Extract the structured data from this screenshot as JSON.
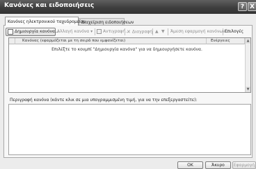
{
  "window": {
    "title": "Κανόνες και ειδοποιήσεις",
    "help_icon": "question-mark-icon",
    "close_icon": "close-x-icon",
    "help_glyph": "?",
    "close_glyph": "X"
  },
  "tabs": [
    {
      "label": "Κανόνες ηλεκτρονικού ταχυδρομείου",
      "active": true
    },
    {
      "label": "Διαχείριση ειδοποιήσεων",
      "active": false
    }
  ],
  "toolbar": {
    "new_rule": "Δημιουργία κανόνα...",
    "change_rule": "Αλλαγή κανόνα",
    "copy": "Αντιγραφή...",
    "delete": "Διαγραφή",
    "run_rules": "Άμεση εφαρμογή κανόνων...",
    "options": "Επιλογές",
    "move_up_glyph": "▲",
    "move_down_glyph": "▼",
    "delete_glyph": "✕",
    "dropdown_glyph": "▾"
  },
  "rules_list": {
    "columns": [
      "",
      "Κανόνας (εφαρμόζεται με τη σειρά που εμφανίζεται)",
      "Ενέργειες"
    ],
    "empty_message": "Επιλέξτε το κουμπί \"Δημιουργία κανόνα\" για να δημιουργήσετε κανόνα."
  },
  "description": {
    "label": "Περιγραφή κανόνα (κάντε κλικ σε μια υπογραμμισμένη τιμή, για να την επεξεργαστείτε):",
    "text": ""
  },
  "buttons": {
    "ok": "OK",
    "cancel": "Άκυρο",
    "apply": "Εφαρμογή"
  }
}
